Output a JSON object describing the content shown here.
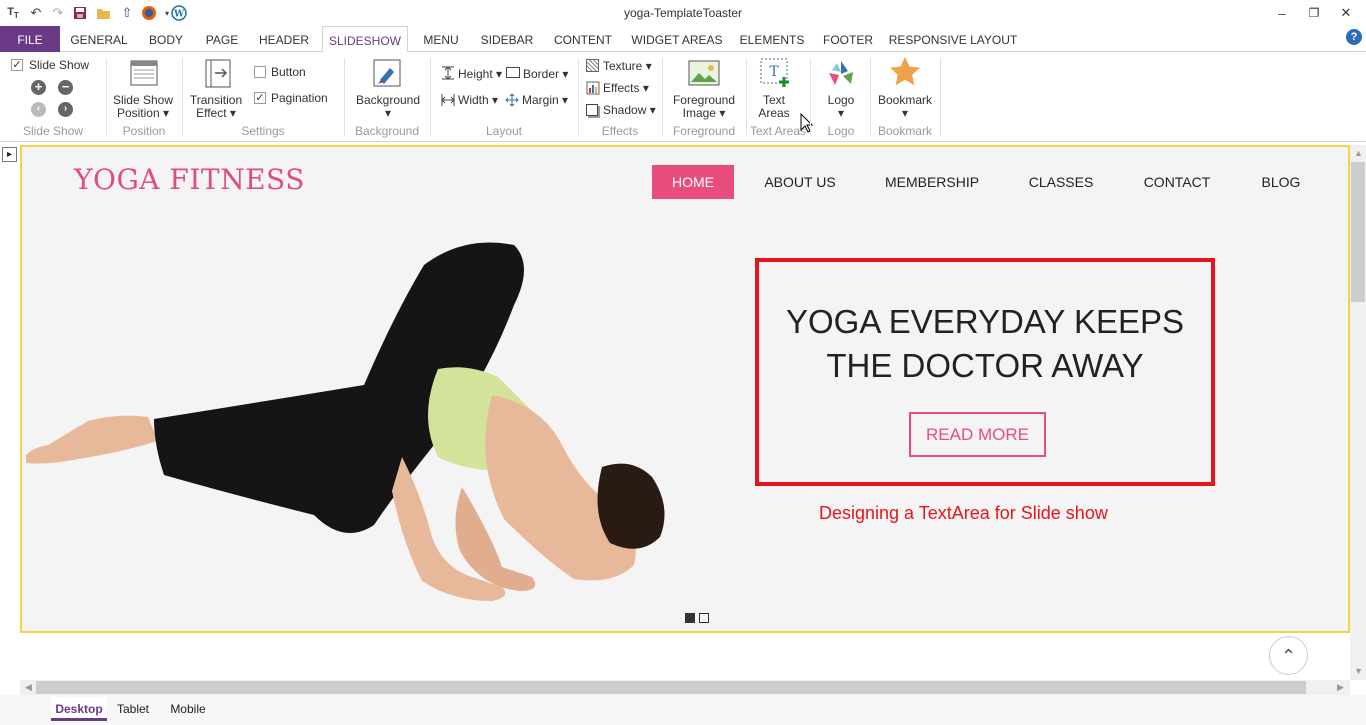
{
  "window": {
    "title": "yoga-TemplateToaster",
    "quick_access": [
      "app-icon",
      "undo-icon",
      "redo-icon",
      "save-icon",
      "open-folder-icon",
      "publish-icon",
      "firefox-icon",
      "wordpress-icon"
    ]
  },
  "tabs": [
    {
      "label": "FILE"
    },
    {
      "label": "GENERAL"
    },
    {
      "label": "BODY"
    },
    {
      "label": "PAGE"
    },
    {
      "label": "HEADER"
    },
    {
      "label": "SLIDESHOW"
    },
    {
      "label": "MENU"
    },
    {
      "label": "SIDEBAR"
    },
    {
      "label": "CONTENT"
    },
    {
      "label": "WIDGET AREAS"
    },
    {
      "label": "ELEMENTS"
    },
    {
      "label": "FOOTER"
    },
    {
      "label": "RESPONSIVE LAYOUT"
    }
  ],
  "ribbon": {
    "slideshow": {
      "toggle_label": "Slide Show",
      "checked": true,
      "group": "Slide Show"
    },
    "position": {
      "label_line1": "Slide Show",
      "label_line2": "Position",
      "group": "Position"
    },
    "settings": {
      "transition_line1": "Transition",
      "transition_line2": "Effect",
      "button_label": "Button",
      "button_checked": false,
      "pagination_label": "Pagination",
      "pagination_checked": true,
      "group": "Settings"
    },
    "background": {
      "label": "Background",
      "group": "Background"
    },
    "layout": {
      "height": "Height",
      "border": "Border",
      "width": "Width",
      "margin": "Margin",
      "group": "Layout"
    },
    "effects": {
      "texture": "Texture",
      "effects": "Effects",
      "shadow": "Shadow",
      "group": "Effects"
    },
    "foreground": {
      "label_line1": "Foreground",
      "label_line2": "Image",
      "group": "Foreground"
    },
    "text_areas": {
      "label_line1": "Text",
      "label_line2": "Areas",
      "group": "Text Areas"
    },
    "logo": {
      "label": "Logo",
      "group": "Logo"
    },
    "bookmark": {
      "label": "Bookmark",
      "group": "Bookmark"
    }
  },
  "site": {
    "logo": "YOGA FITNESS",
    "nav": [
      "HOME",
      "ABOUT US",
      "MEMBERSHIP",
      "CLASSES",
      "CONTACT",
      "BLOG"
    ],
    "active_nav": "HOME",
    "headline_line1": "YOGA EVERYDAY KEEPS",
    "headline_line2": "THE DOCTOR AWAY",
    "read_more": "READ MORE",
    "slide_count": 2,
    "active_slide": 1
  },
  "annotation": "Designing a TextArea for Slide show",
  "device_tabs": [
    "Desktop",
    "Tablet",
    "Mobile"
  ],
  "active_device": "Desktop",
  "colors": {
    "brand_purple": "#6b3a86",
    "accent_pink": "#e84d7d",
    "highlight_red": "#e8141c",
    "canvas_border": "#f2d34a"
  }
}
